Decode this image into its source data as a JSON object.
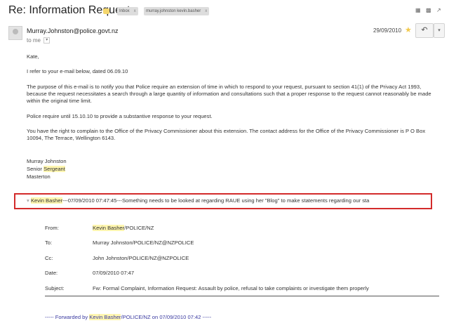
{
  "header": {
    "title": "Re: Information Request",
    "labels": [
      "Inbox",
      "murray.johnston kevin.basher"
    ],
    "label_close": "x"
  },
  "message": {
    "sender": "Murray.Johnston@police.govt.nz",
    "to": "to me",
    "date": "29/09/2010",
    "greeting": "Kate,",
    "para1": "I refer to your e-mail below, dated 06.09.10",
    "para2": "The purpose of this e-mail is to notify you that Police require an extension of time in which to respond to your request, pursuant to section 41(1) of the Privacy Act 1993, because the request necessitates a search through a large quantity of information and consultations such that a proper response to the request cannot reasonably be made within the original time limit.",
    "para3": "Police require until 15.10.10 to provide a substantive response to your request.",
    "para4": "You have the right to complain to the Office of the Privacy Commissioner about this extension. The contact address for the Office of the Privacy Commissioner is P O Box 10094, The Terrace, Wellington 6143.",
    "sig_name": "Murray Johnston",
    "sig_title_pre": "Senior ",
    "sig_title_hl": "Sergeant",
    "sig_place": "Masterton"
  },
  "quoted": {
    "caret": "▾",
    "name": "Kevin Basher",
    "summary": "---07/09/2010 07:47:45---Something needs to be looked at regarding RAUE using her \"Blog\" to make statements regarding our sta",
    "from_label": "From:",
    "from_name": "Kevin Basher",
    "from_suffix": "/POLICE/NZ",
    "to_label": "To:",
    "to_val": "Murray Johnston/POLICE/NZ@NZPOLICE",
    "cc_label": "Cc:",
    "cc_val": "John Johnston/POLICE/NZ@NZPOLICE",
    "date_label": "Date:",
    "date_val": "07/09/2010 07:47",
    "subject_label": "Subject:",
    "subject_val": "Fw: Formal Complaint, Information Request: Assault by police, refusal to take complaints or investigate them properly",
    "fwd_pre": "----- Forwarded by ",
    "fwd_name": "Kevin Basher",
    "fwd_post": "/POLICE/NZ on 07/09/2010 07:42 -----"
  },
  "colors": {
    "highlight": "#fff6b0",
    "box_border": "#d32b2b",
    "star": "#f2c94c"
  },
  "icons": [
    "archive-icon",
    "print-icon",
    "new-window-icon",
    "star-icon",
    "reply-icon",
    "more-icon"
  ]
}
